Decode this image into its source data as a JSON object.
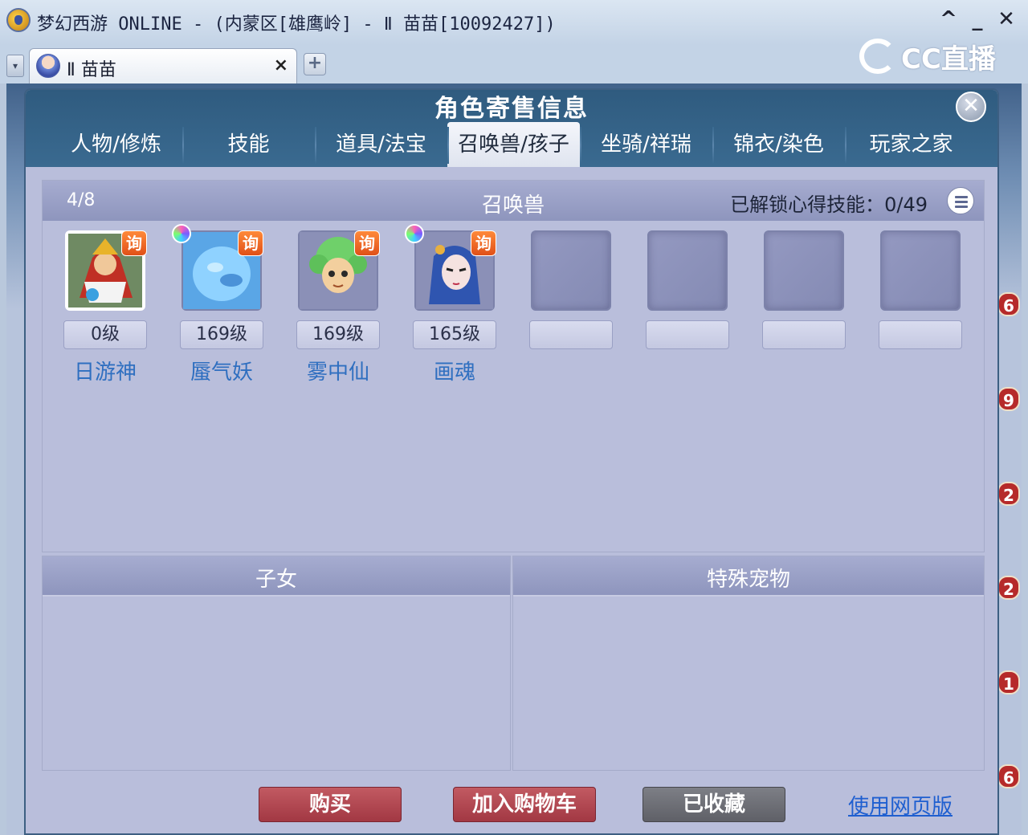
{
  "window": {
    "title": "梦幻西游 ONLINE - (内蒙区[雄鹰岭] - Ⅱ 苗苗[10092427])",
    "minimize": "_",
    "collapse": "^",
    "close": "✕"
  },
  "browser": {
    "tab_label": "Ⅱ 苗苗",
    "tab_close": "×",
    "tab_add": "+",
    "dropdown": "▾",
    "logo_text": "CC直播"
  },
  "dialog": {
    "title": "角色寄售信息",
    "close": "✕",
    "tabs": [
      {
        "label": "人物/修炼"
      },
      {
        "label": "技能"
      },
      {
        "label": "道具/法宝"
      },
      {
        "label": "召唤兽/孩子",
        "active": true
      },
      {
        "label": "坐骑/祥瑞"
      },
      {
        "label": "锦衣/染色"
      },
      {
        "label": "玩家之家"
      }
    ]
  },
  "summon_panel": {
    "count": "4/8",
    "title": "召唤兽",
    "skill_unlock": "已解锁心得技能：0/49",
    "inquire_label": "询",
    "pets": [
      {
        "level": "0级",
        "name": "日游神",
        "selected": true
      },
      {
        "level": "169级",
        "name": "蜃气妖",
        "gem": true
      },
      {
        "level": "169级",
        "name": "雾中仙"
      },
      {
        "level": "165级",
        "name": "画魂",
        "gem": true
      }
    ]
  },
  "children_panel": {
    "title": "子女"
  },
  "special_panel": {
    "title": "特殊宠物"
  },
  "actions": {
    "buy": "购买",
    "add_cart": "加入购物车",
    "favorited": "已收藏",
    "web_version": "使用网页版"
  },
  "side_badges": [
    "6",
    "9",
    "2",
    "2",
    "1",
    "6"
  ],
  "colors": {
    "header": "#3a6a90",
    "panel_bg": "#b9bedb",
    "button_red": "#a23843",
    "button_gray": "#5f6067",
    "pet_name": "#2f6fc0",
    "link": "#1f5fd0"
  }
}
